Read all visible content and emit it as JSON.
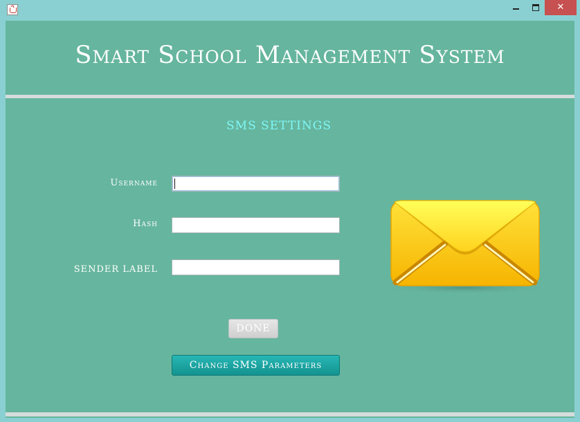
{
  "window": {
    "app_icon": "java-coffee-cup-icon",
    "controls": {
      "minimize": "minimize-icon",
      "maximize": "maximize-icon",
      "close_label": "✕"
    }
  },
  "header": {
    "title": "Smart School Management System"
  },
  "section": {
    "title": "SMS SETTINGS"
  },
  "form": {
    "username": {
      "label": "Username",
      "value": "",
      "placeholder": ""
    },
    "hash": {
      "label": "Hash",
      "value": "",
      "placeholder": ""
    },
    "sender_label": {
      "label": "SENDER LABEL",
      "value": "",
      "placeholder": ""
    }
  },
  "buttons": {
    "done_label": "DONE",
    "change_label": "Change SMS Parameters"
  },
  "graphic": {
    "icon": "envelope-icon"
  },
  "colors": {
    "panel_background": "#66b59e",
    "window_frame": "#8ad0d2",
    "section_title": "#7ff7f7",
    "primary_button": "#17a6a3",
    "close_button": "#c75050"
  }
}
